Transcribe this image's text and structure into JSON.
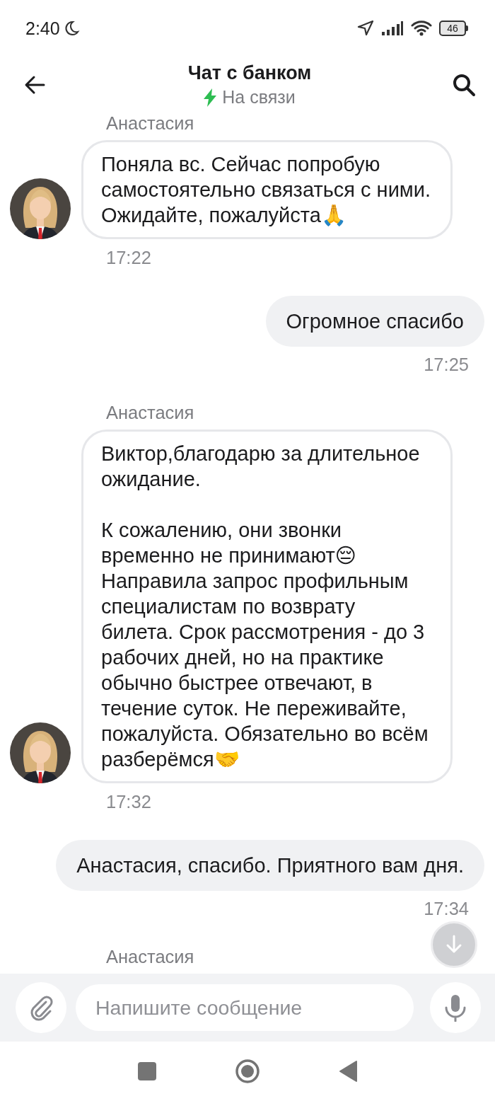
{
  "status_bar": {
    "time": "2:40",
    "battery": "46"
  },
  "header": {
    "title": "Чат с банком",
    "status": "На связи"
  },
  "messages": [
    {
      "kind": "incoming",
      "sender": "Анастасия",
      "text": "Поняла вс. Сейчас попробую самостоятельно связаться с ними. Ожидайте, пожалуйста🙏",
      "time": "17:22"
    },
    {
      "kind": "outgoing",
      "text": "Огромное спасибо",
      "time": "17:25"
    },
    {
      "kind": "incoming",
      "sender": "Анастасия",
      "text": "Виктор,благодарю за длительное ожидание.\n\nК сожалению, они звонки временно не принимают😔 Направила запрос профильным специалистам по возврату билета. Срок рассмотрения - до 3 рабочих дней, но на практике обычно быстрее отвечают, в течение суток. Не переживайте, пожалуйста. Обязательно во всём разберёмся🤝",
      "time": "17:32"
    },
    {
      "kind": "outgoing",
      "text": "Анастасия, спасибо. Приятного вам дня.",
      "time": "17:34"
    },
    {
      "kind": "incoming",
      "sender": "Анастасия"
    }
  ],
  "composer": {
    "placeholder": "Напишите сообщение"
  }
}
